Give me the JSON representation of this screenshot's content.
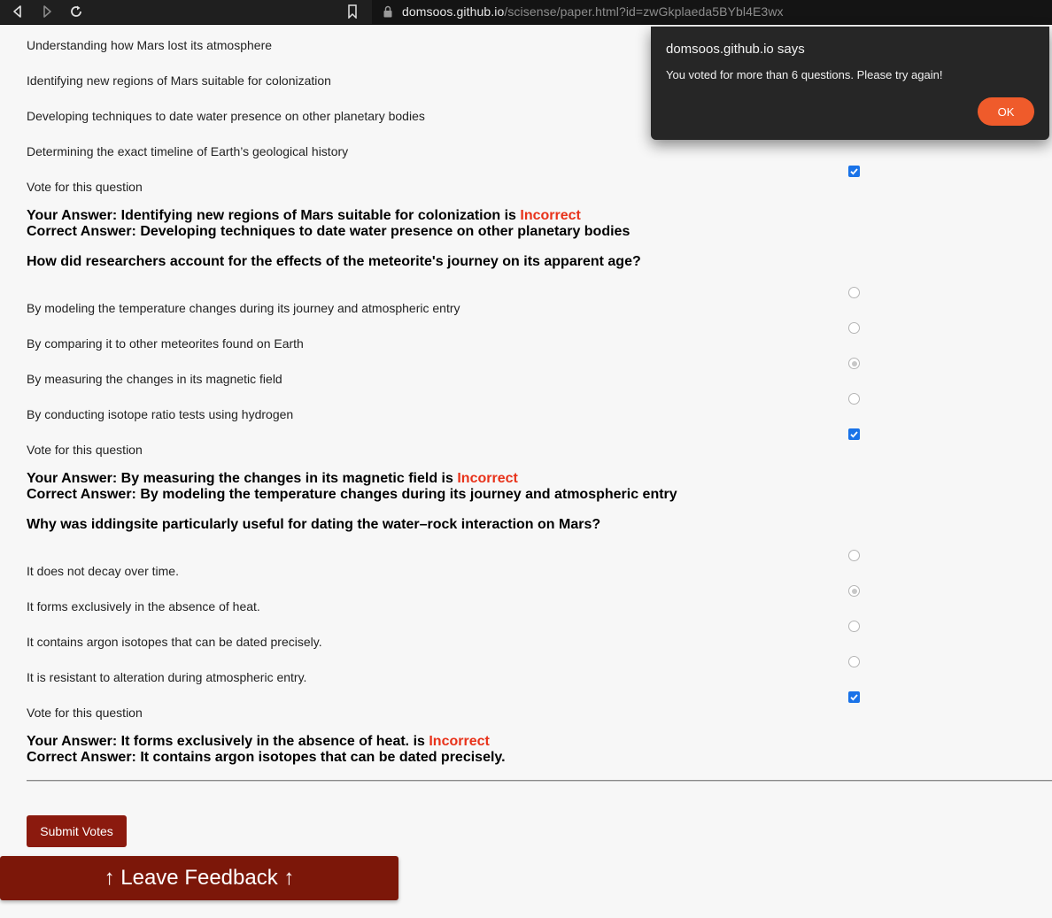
{
  "browser": {
    "url_host": "domsoos.github.io",
    "url_path": "/scisense/paper.html?id=zwGkplaeda5BYbl4E3wx"
  },
  "dialog": {
    "title": "domsoos.github.io says",
    "message": "You voted for more than 6 questions. Please try again!",
    "ok_label": "OK"
  },
  "q1": {
    "options": [
      "Understanding how Mars lost its atmosphere",
      "Identifying new regions of Mars suitable for colonization",
      "Developing techniques to date water presence on other planetary bodies",
      "Determining the exact timeline of Earth’s geological history"
    ],
    "vote_label": "Vote for this question",
    "your_answer_prefix": "Your Answer: Identifying new regions of Mars suitable for colonization is ",
    "result": "Incorrect",
    "correct_answer": "Correct Answer: Developing techniques to date water presence on other planetary bodies"
  },
  "q2": {
    "question": "How did researchers account for the effects of the meteorite's journey on its apparent age?",
    "options": [
      "By modeling the temperature changes during its journey and atmospheric entry",
      "By comparing it to other meteorites found on Earth",
      "By measuring the changes in its magnetic field",
      "By conducting isotope ratio tests using hydrogen"
    ],
    "vote_label": "Vote for this question",
    "your_answer_prefix": "Your Answer: By measuring the changes in its magnetic field is ",
    "result": "Incorrect",
    "correct_answer": "Correct Answer: By modeling the temperature changes during its journey and atmospheric entry"
  },
  "q3": {
    "question": "Why was iddingsite particularly useful for dating the water–rock interaction on Mars?",
    "options": [
      "It does not decay over time.",
      "It forms exclusively in the absence of heat.",
      "It contains argon isotopes that can be dated precisely.",
      "It is resistant to alteration during atmospheric entry."
    ],
    "vote_label": "Vote for this question",
    "your_answer_prefix": "Your Answer: It forms exclusively in the absence of heat. is ",
    "result": "Incorrect",
    "correct_answer": "Correct Answer: It contains argon isotopes that can be dated precisely."
  },
  "buttons": {
    "submit": "Submit Votes",
    "feedback": "↑ Leave Feedback ↑"
  },
  "colors": {
    "incorrect": "#e8321a",
    "submit_bg": "#8b1a0e",
    "ok_bg": "#ef5b2b",
    "checkbox": "#1a73e8"
  }
}
